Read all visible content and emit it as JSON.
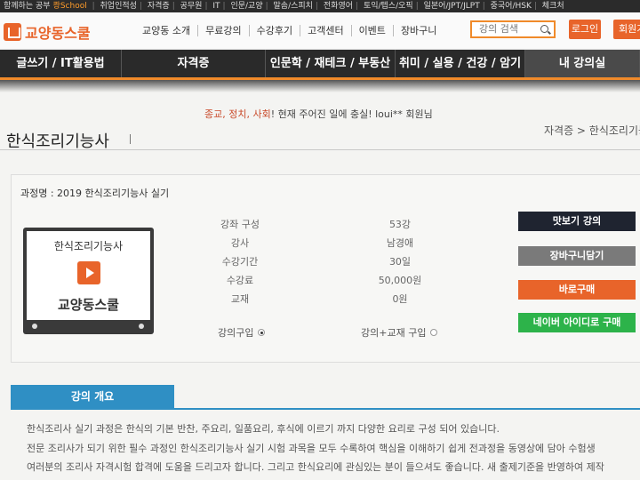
{
  "topbar": {
    "items": [
      "함께하는 공부",
      "School",
      "취업인적성",
      "자격증",
      "공무원",
      "IT",
      "인문/교양",
      "말솜/스피치",
      "전화영어",
      "토익/텝스/오픽",
      "일본어/JPT/JLPT",
      "중국어/HSK",
      "체크처"
    ],
    "highlight": "쾅School"
  },
  "header": {
    "logo_text": "교양동스쿨",
    "nav": [
      "교양동 소개",
      "무료강의",
      "수강후기",
      "고객센터",
      "이벤트",
      "장바구니"
    ],
    "search_placeholder": "강의 검색",
    "login": "로그인",
    "join": "회원가"
  },
  "categories": [
    "글쓰기 / IT활용법",
    "자격증",
    "인문학 / 재테크 / 부동산",
    "취미 / 실용 / 건강 / 암기",
    "내 강의실"
  ],
  "notice": {
    "red_part": "종교, 정치, 사회",
    "rest": "! 현재 주어진 일에 충실! loui** 회원님"
  },
  "page": {
    "title": "한식조리기능사",
    "breadcrumb": "자격증 > 한식조리기능"
  },
  "course": {
    "name": "과정명 : 2019 한식조리기능사 실기",
    "thumb_title": "한식조리기능사",
    "thumb_brand": "교양동스쿨",
    "info": [
      {
        "label": "강좌 구성",
        "value": "53강"
      },
      {
        "label": "강사",
        "value": "남경애"
      },
      {
        "label": "수강기간",
        "value": "30일"
      },
      {
        "label": "수강료",
        "value": "50,000원"
      },
      {
        "label": "교재",
        "value": "0원"
      }
    ],
    "options": [
      {
        "label": "강의구입",
        "checked": true
      },
      {
        "label": "강의+교재 구입",
        "checked": false
      }
    ],
    "buttons": {
      "preview": "맛보기 강의",
      "cart": "장바구니담기",
      "buy": "바로구매",
      "naver": "네이버 아이디로 구매"
    }
  },
  "overview": {
    "tab": "강의 개요",
    "lines": [
      "한식조리사 실기 과정은 한식의 기본 반찬, 주요리, 일품요리, 후식에 이르기 까지 다양한 요리로 구성 되어 있습니다.",
      "전문 조리사가 되기 위한 필수 과정인 한식조리기능사 실기 시험 과목을 모두 수록하여 핵심을 이해하기 쉽게 전과정을 동영상에 담아 수험생",
      "여러분의 조리사 자격시험 합격에 도움을 드리고자 합니다. 그리고 한식요리에 관심있는 분이 들으셔도 좋습니다. 새 출제기준을 반영하여 제작"
    ]
  },
  "colors": {
    "brand_orange": "#e8642a",
    "dark_nav": "#2a2a2a",
    "accent_blue": "#2f8fc4",
    "naver_green": "#2db34a"
  }
}
